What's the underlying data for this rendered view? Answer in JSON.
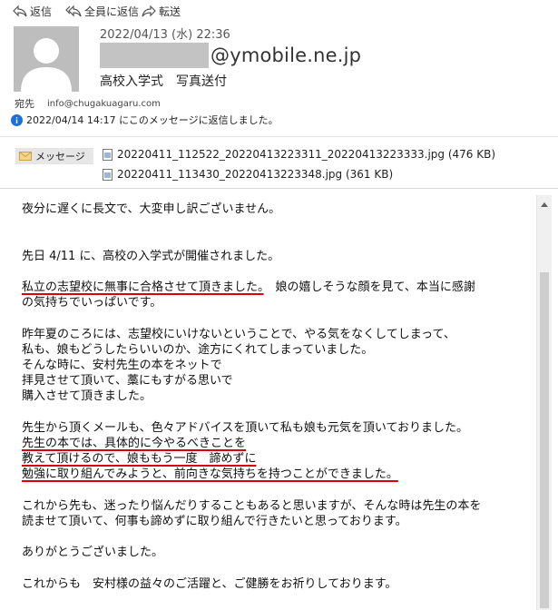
{
  "toolbar": {
    "reply_label": "返信",
    "reply_all_label": "全員に返信",
    "forward_label": "転送"
  },
  "header": {
    "date": "2022/04/13 (水) 22:36",
    "sender_domain": "@ymobile.ne.jp",
    "subject": "高校入学式　写真送付",
    "to_label": "宛先",
    "to_address": "info@chugakuagaru.com",
    "reply_info": "2022/04/14 14:17 にこのメッセージに返信しました。"
  },
  "attachments": {
    "message_tab": "メッセージ",
    "files": [
      "20220411_112522_20220413223311_20220413223333.jpg (476 KB)",
      "20220411_113430_20220413223348.jpg (361 KB)"
    ]
  },
  "body": {
    "l1": "夜分に遅くに長文で、大変申し訳ございません。",
    "l2": "先日 4/11 に、高校の入学式が開催されました。",
    "l3a": "私立の志望校に無事に合格させて頂きました。",
    "l3b": "　娘の嬉しそうな顔を見て、本当に感謝",
    "l4": "の気持ちでいっぱいです。",
    "l5": "昨年夏のころには、志望校にいけないということで、やる気をなくしてしまって、",
    "l6": "私も、娘もどうしたらいいのか、途方にくれてしまっていました。",
    "l7": "そんな時に、安村先生の本をネットで",
    "l8": "拝見させて頂いて、藁にもすがる思いで",
    "l9": "購入させて頂きました。",
    "l10": "先生から頂くメールも、色々アドバイスを頂いて私も娘も元気を頂いておりました。",
    "l11": "先生の本では、具体的に今やるべきことを",
    "l12": "教えて頂けるので、娘ももう一度　諦めずに",
    "l13": "勉強に取り組んでみようと、前向きな気持ちを持つことができました。",
    "l14": "これから先も、迷ったり悩んだりすることもあると思いますが、そんな時は先生の本を",
    "l15": "読ませて頂いて、何事も諦めずに取り組んで行きたいと思っております。",
    "l16": "ありがとうございました。",
    "l17": "これからも　安村様の益々のご活躍と、ご健勝をお祈りしております。"
  },
  "colors": {
    "underline": "#d8000c",
    "avatar_bg": "#bdbdbd",
    "info_icon": "#1e6fd9"
  }
}
